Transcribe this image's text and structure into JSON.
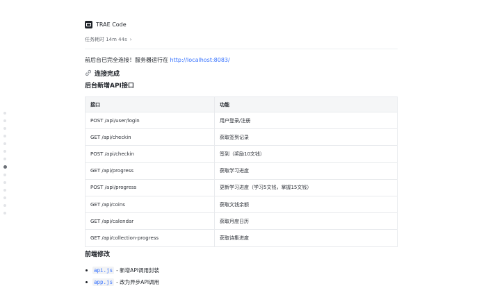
{
  "header": {
    "app_name": "TRAE Code",
    "task_time": "任务耗时 14m 44s"
  },
  "status": {
    "prefix": "前后台已完全连接！服务器运行在",
    "url": "http://localhost:8083/"
  },
  "headings": {
    "done": "连接完成",
    "api_section": "后台新增API接口",
    "frontend_section": "前端修改"
  },
  "table": {
    "columns": [
      "接口",
      "功能"
    ],
    "rows": [
      [
        "POST /api/user/login",
        "用户登录/注册"
      ],
      [
        "GET /api/checkin",
        "获取签到记录"
      ],
      [
        "POST /api/checkin",
        "签到（奖励10文钱）"
      ],
      [
        "GET /api/progress",
        "获取学习进度"
      ],
      [
        "POST /api/progress",
        "更新学习进度（学习5文钱，掌握15文钱）"
      ],
      [
        "GET /api/coins",
        "获取文钱余额"
      ],
      [
        "GET /api/calendar",
        "获取月度日历"
      ],
      [
        "GET /api/collection-progress",
        "获取诗集进度"
      ]
    ]
  },
  "frontend": {
    "items": [
      {
        "file": "api.js",
        "desc": "- 新增API调用封装"
      },
      {
        "file": "app.js",
        "desc": "- 改为异步API调用"
      }
    ]
  },
  "icons": {
    "app": "trae-logo-icon",
    "expand": "chevron-right-icon",
    "link": "link-icon"
  },
  "colors": {
    "link": "#3370ff",
    "table_header_bg": "#f5f6f7"
  }
}
